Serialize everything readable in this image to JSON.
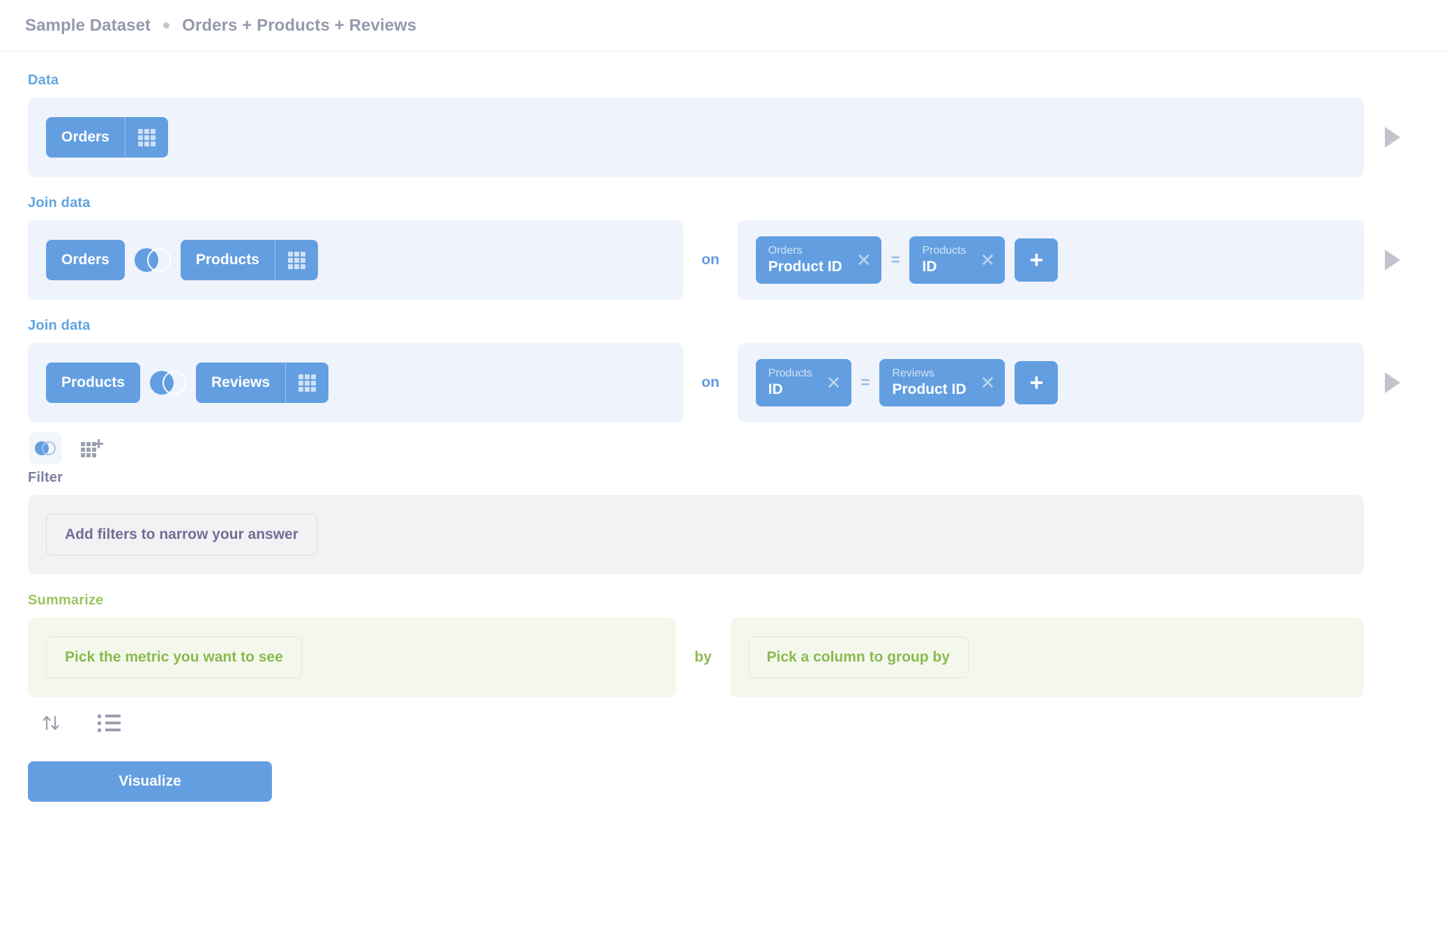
{
  "header": {
    "database": "Sample Dataset",
    "separator_icon": "dot-separator-icon",
    "question_title": "Orders + Products + Reviews"
  },
  "colors": {
    "blue": "#639ee1",
    "blue_band": "#eef3fc",
    "purple_text": "#6f6f96",
    "purple_band": "#f2f2f5",
    "green_text": "#8aba50",
    "green_band": "#f4f8ec",
    "muted_gray": "#9aa0ad"
  },
  "steps": {
    "data": {
      "title": "Data",
      "table": "Orders",
      "table_picker_icon": "table-grid-icon",
      "preview_icon": "play-preview-icon"
    },
    "joins": [
      {
        "title": "Join data",
        "left_table": "Orders",
        "join_type_icon": "left-join-venn-icon",
        "right_table": "Products",
        "right_table_picker_icon": "table-grid-icon",
        "on_label": "on",
        "condition": {
          "left": {
            "table": "Orders",
            "column": "Product ID",
            "remove_icon": "close-icon"
          },
          "operator": "=",
          "right": {
            "table": "Products",
            "column": "ID",
            "remove_icon": "close-icon"
          }
        },
        "add_condition_icon": "plus-icon",
        "preview_icon": "play-preview-icon"
      },
      {
        "title": "Join data",
        "left_table": "Products",
        "join_type_icon": "left-join-venn-icon",
        "right_table": "Reviews",
        "right_table_picker_icon": "table-grid-icon",
        "on_label": "on",
        "condition": {
          "left": {
            "table": "Products",
            "column": "ID",
            "remove_icon": "close-icon"
          },
          "operator": "=",
          "right": {
            "table": "Reviews",
            "column": "Product ID",
            "remove_icon": "close-icon"
          }
        },
        "add_condition_icon": "plus-icon",
        "preview_icon": "play-preview-icon"
      }
    ],
    "join_actions": {
      "join_icon": "join-venn-icon",
      "add_data_icon": "grid-plus-icon"
    },
    "filter": {
      "title": "Filter",
      "placeholder": "Add filters to narrow your answer"
    },
    "summarize": {
      "title": "Summarize",
      "metric_placeholder": "Pick the metric you want to see",
      "by_label": "by",
      "group_placeholder": "Pick a column to group by"
    },
    "bottom_actions": {
      "sort_icon": "sort-arrows-icon",
      "limit_icon": "row-limit-list-icon"
    }
  },
  "footer": {
    "visualize_label": "Visualize"
  }
}
